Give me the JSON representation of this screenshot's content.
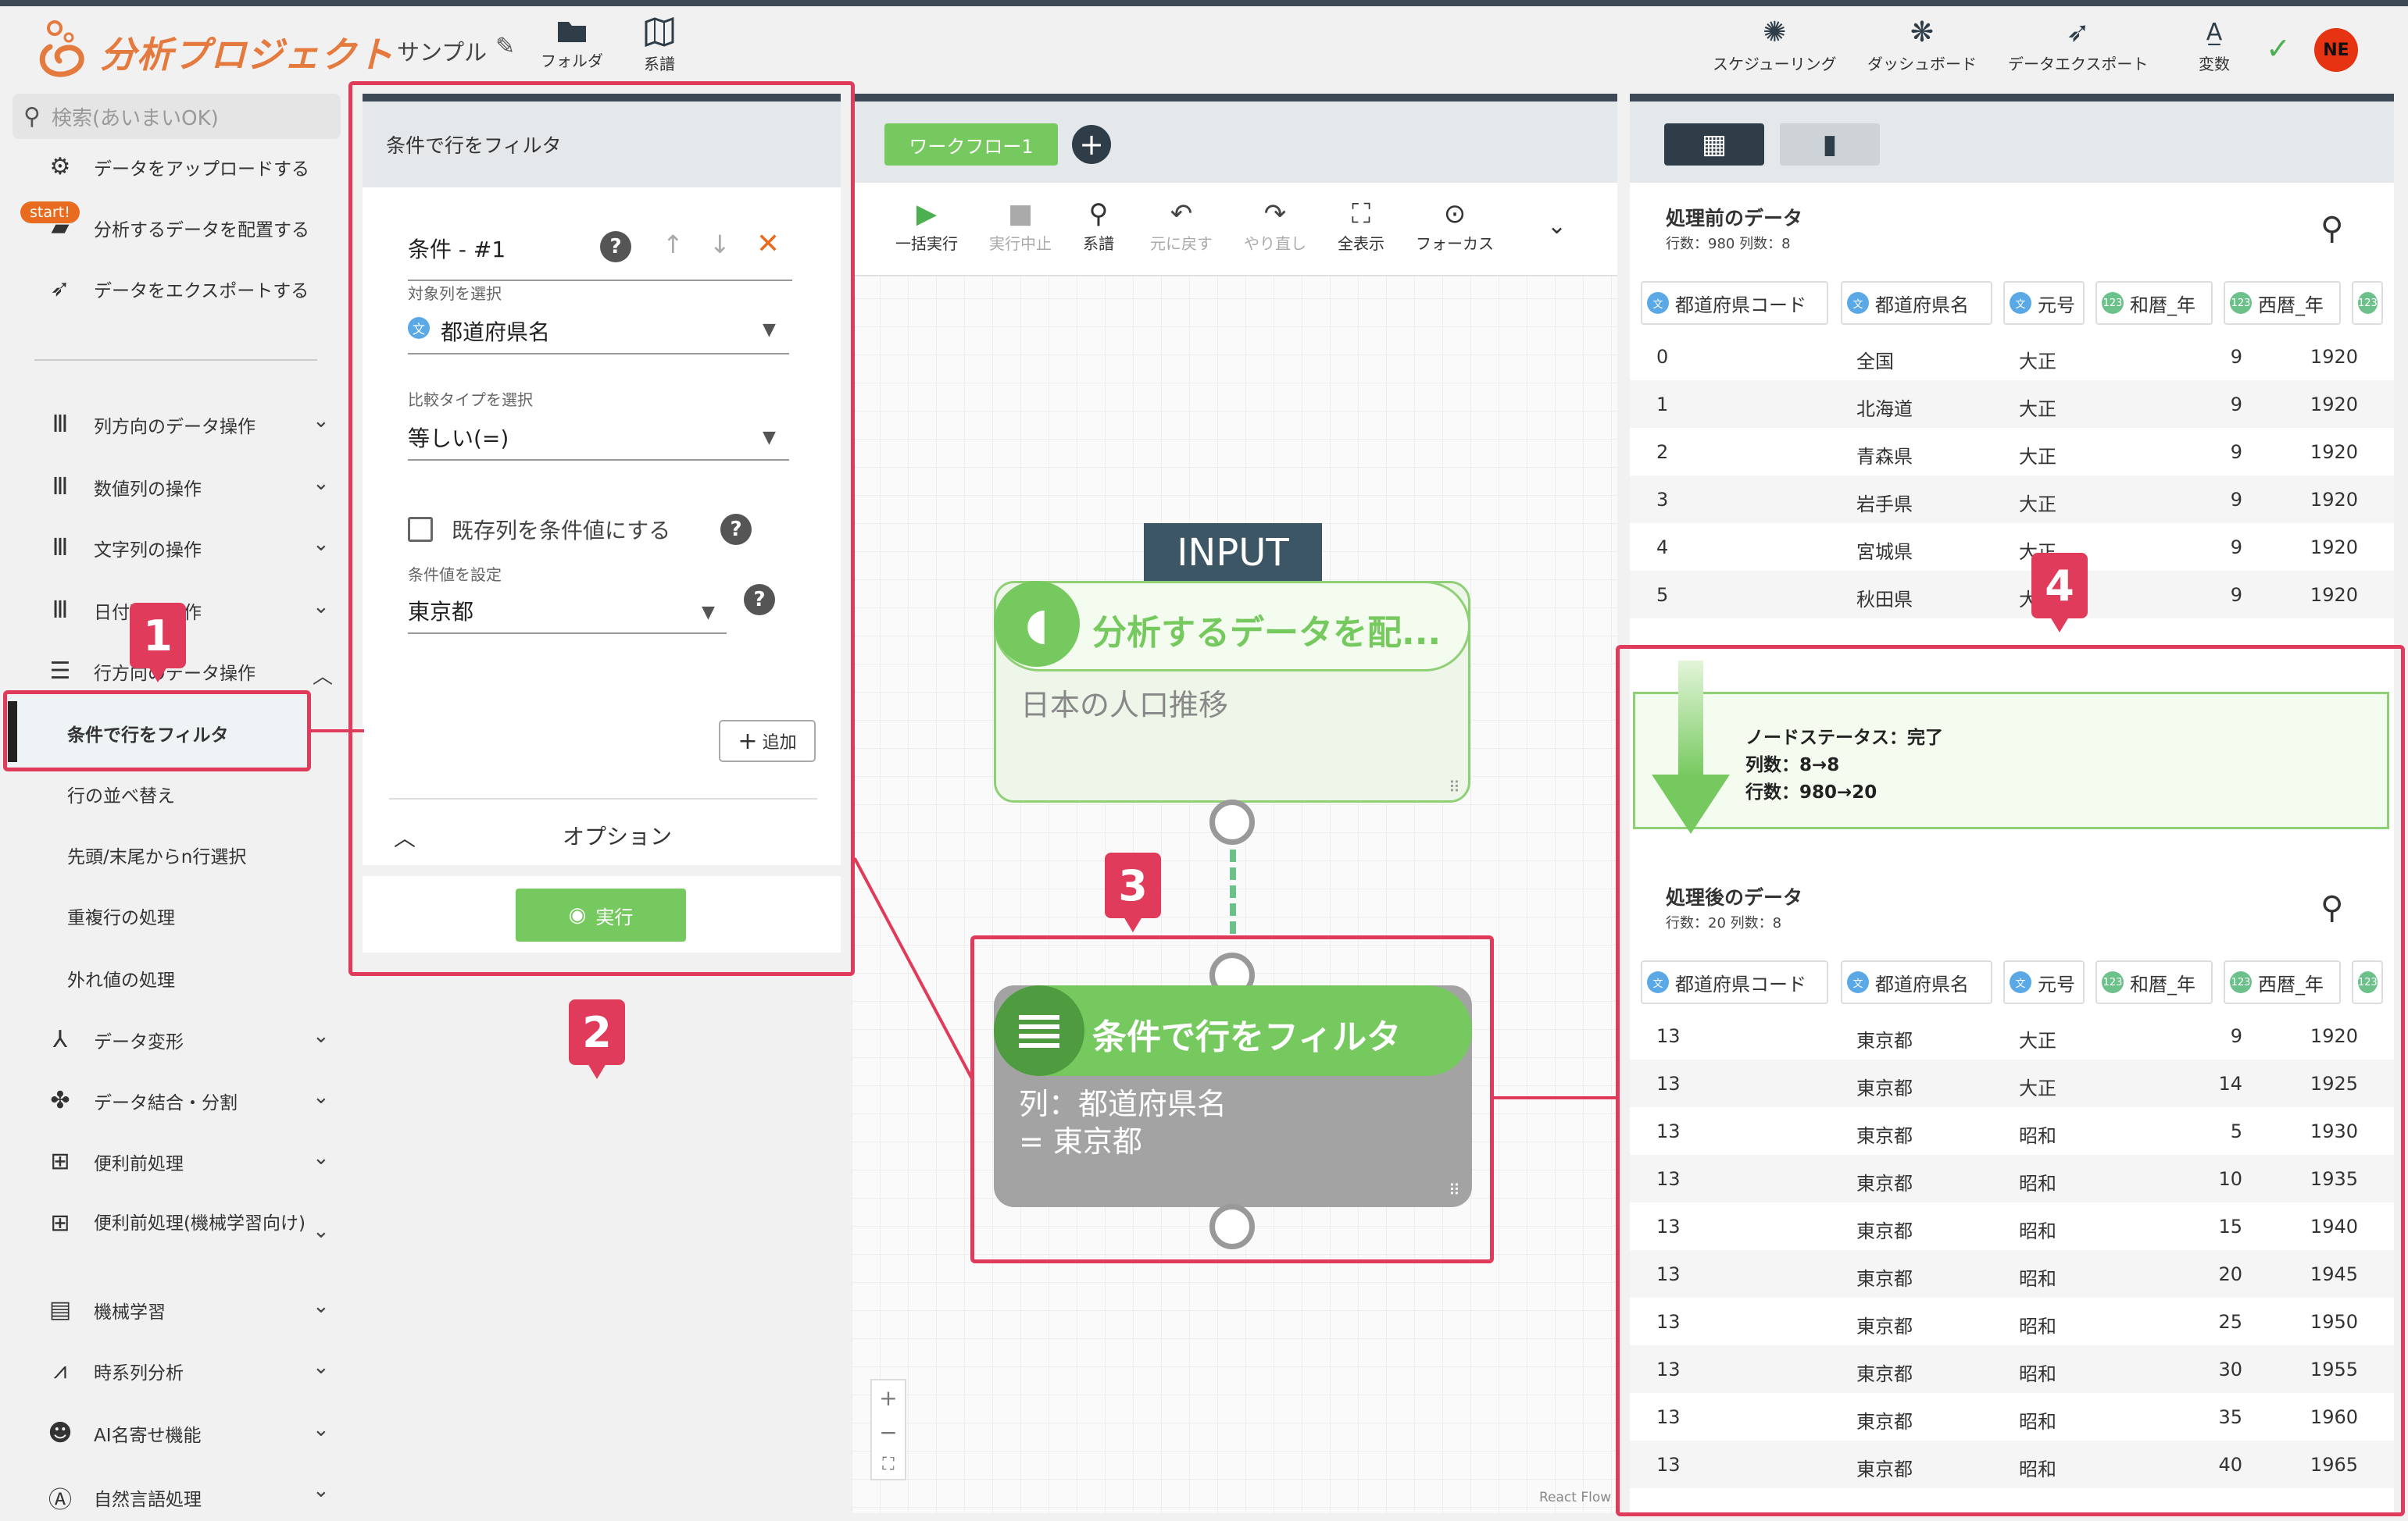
{
  "header": {
    "app_title": "分析プロジェクト",
    "project_name": "サンプル",
    "folder_label": "フォルダ",
    "lineage_label": "系譜",
    "schedule_label": "スケジューリング",
    "dashboard_label": "ダッシュボード",
    "export_label": "データエクスポート",
    "variables_label": "変数",
    "avatar_initials": "NE"
  },
  "sidebar": {
    "search_placeholder": "検索(あいまいOK)",
    "start_badge": "start!",
    "quick": [
      "データをアップロードする",
      "分析するデータを配置する",
      "データをエクスポートする"
    ],
    "groups": [
      "列方向のデータ操作",
      "数値列の操作",
      "文字列の操作",
      "日付列の操作",
      "行方向のデータ操作"
    ],
    "row_ops": [
      "条件で行をフィルタ",
      "行の並べ替え",
      "先頭/末尾からn行選択",
      "重複行の処理",
      "外れ値の処理"
    ],
    "more_groups": [
      "データ変形",
      "データ結合・分割",
      "便利前処理",
      "便利前処理(機械学習向け)",
      "機械学習",
      "時系列分析",
      "AI名寄せ機能",
      "自然言語処理"
    ]
  },
  "filter_panel": {
    "title": "条件で行をフィルタ",
    "condition_label": "条件 - #1",
    "target_col_label": "対象列を選択",
    "target_col_value": "都道府県名",
    "compare_label": "比較タイプを選択",
    "compare_value": "等しい(=)",
    "existing_col_label": "既存列を条件値にする",
    "cond_value_label": "条件値を設定",
    "cond_value": "東京都",
    "add_label": "追加",
    "options_label": "オプション",
    "run_label": "実行"
  },
  "canvas": {
    "workflow_tab": "ワークフロー1",
    "toolbar": [
      "一括実行",
      "実行中止",
      "系譜",
      "元に戻す",
      "やり直し",
      "全表示",
      "フォーカス"
    ],
    "input_label": "INPUT",
    "node1_title": "分析するデータを配...",
    "node1_sub": "日本の人口推移",
    "node2_title": "条件で行をフィルタ",
    "node2_line1": "列：都道府県名",
    "node2_line2": "= 東京都",
    "footer": "React Flow"
  },
  "right": {
    "before_title": "処理前のデータ",
    "before_meta": "行数：980 列数：8",
    "after_title": "処理後のデータ",
    "after_meta": "行数：20 列数：8",
    "columns": [
      "都道府県コード",
      "都道府県名",
      "元号",
      "和暦_年",
      "西暦_年"
    ],
    "status_title": "ノードステータス：完了",
    "status_cols": "列数：8→8",
    "status_rows": "行数：980→20",
    "before_rows": [
      [
        "0",
        "全国",
        "大正",
        "9",
        "1920"
      ],
      [
        "1",
        "北海道",
        "大正",
        "9",
        "1920"
      ],
      [
        "2",
        "青森県",
        "大正",
        "9",
        "1920"
      ],
      [
        "3",
        "岩手県",
        "大正",
        "9",
        "1920"
      ],
      [
        "4",
        "宮城県",
        "大正",
        "9",
        "1920"
      ],
      [
        "5",
        "秋田県",
        "大正",
        "9",
        "1920"
      ]
    ],
    "after_rows": [
      [
        "13",
        "東京都",
        "大正",
        "9",
        "1920"
      ],
      [
        "13",
        "東京都",
        "大正",
        "14",
        "1925"
      ],
      [
        "13",
        "東京都",
        "昭和",
        "5",
        "1930"
      ],
      [
        "13",
        "東京都",
        "昭和",
        "10",
        "1935"
      ],
      [
        "13",
        "東京都",
        "昭和",
        "15",
        "1940"
      ],
      [
        "13",
        "東京都",
        "昭和",
        "20",
        "1945"
      ],
      [
        "13",
        "東京都",
        "昭和",
        "25",
        "1950"
      ],
      [
        "13",
        "東京都",
        "昭和",
        "30",
        "1955"
      ],
      [
        "13",
        "東京都",
        "昭和",
        "35",
        "1960"
      ],
      [
        "13",
        "東京都",
        "昭和",
        "40",
        "1965"
      ]
    ]
  },
  "annotations": [
    "1",
    "2",
    "3",
    "4"
  ],
  "colors": {
    "accent": "#76c95f",
    "highlight": "#e13b5b",
    "brand": "#e47a3d",
    "dark": "#3d4a55"
  }
}
